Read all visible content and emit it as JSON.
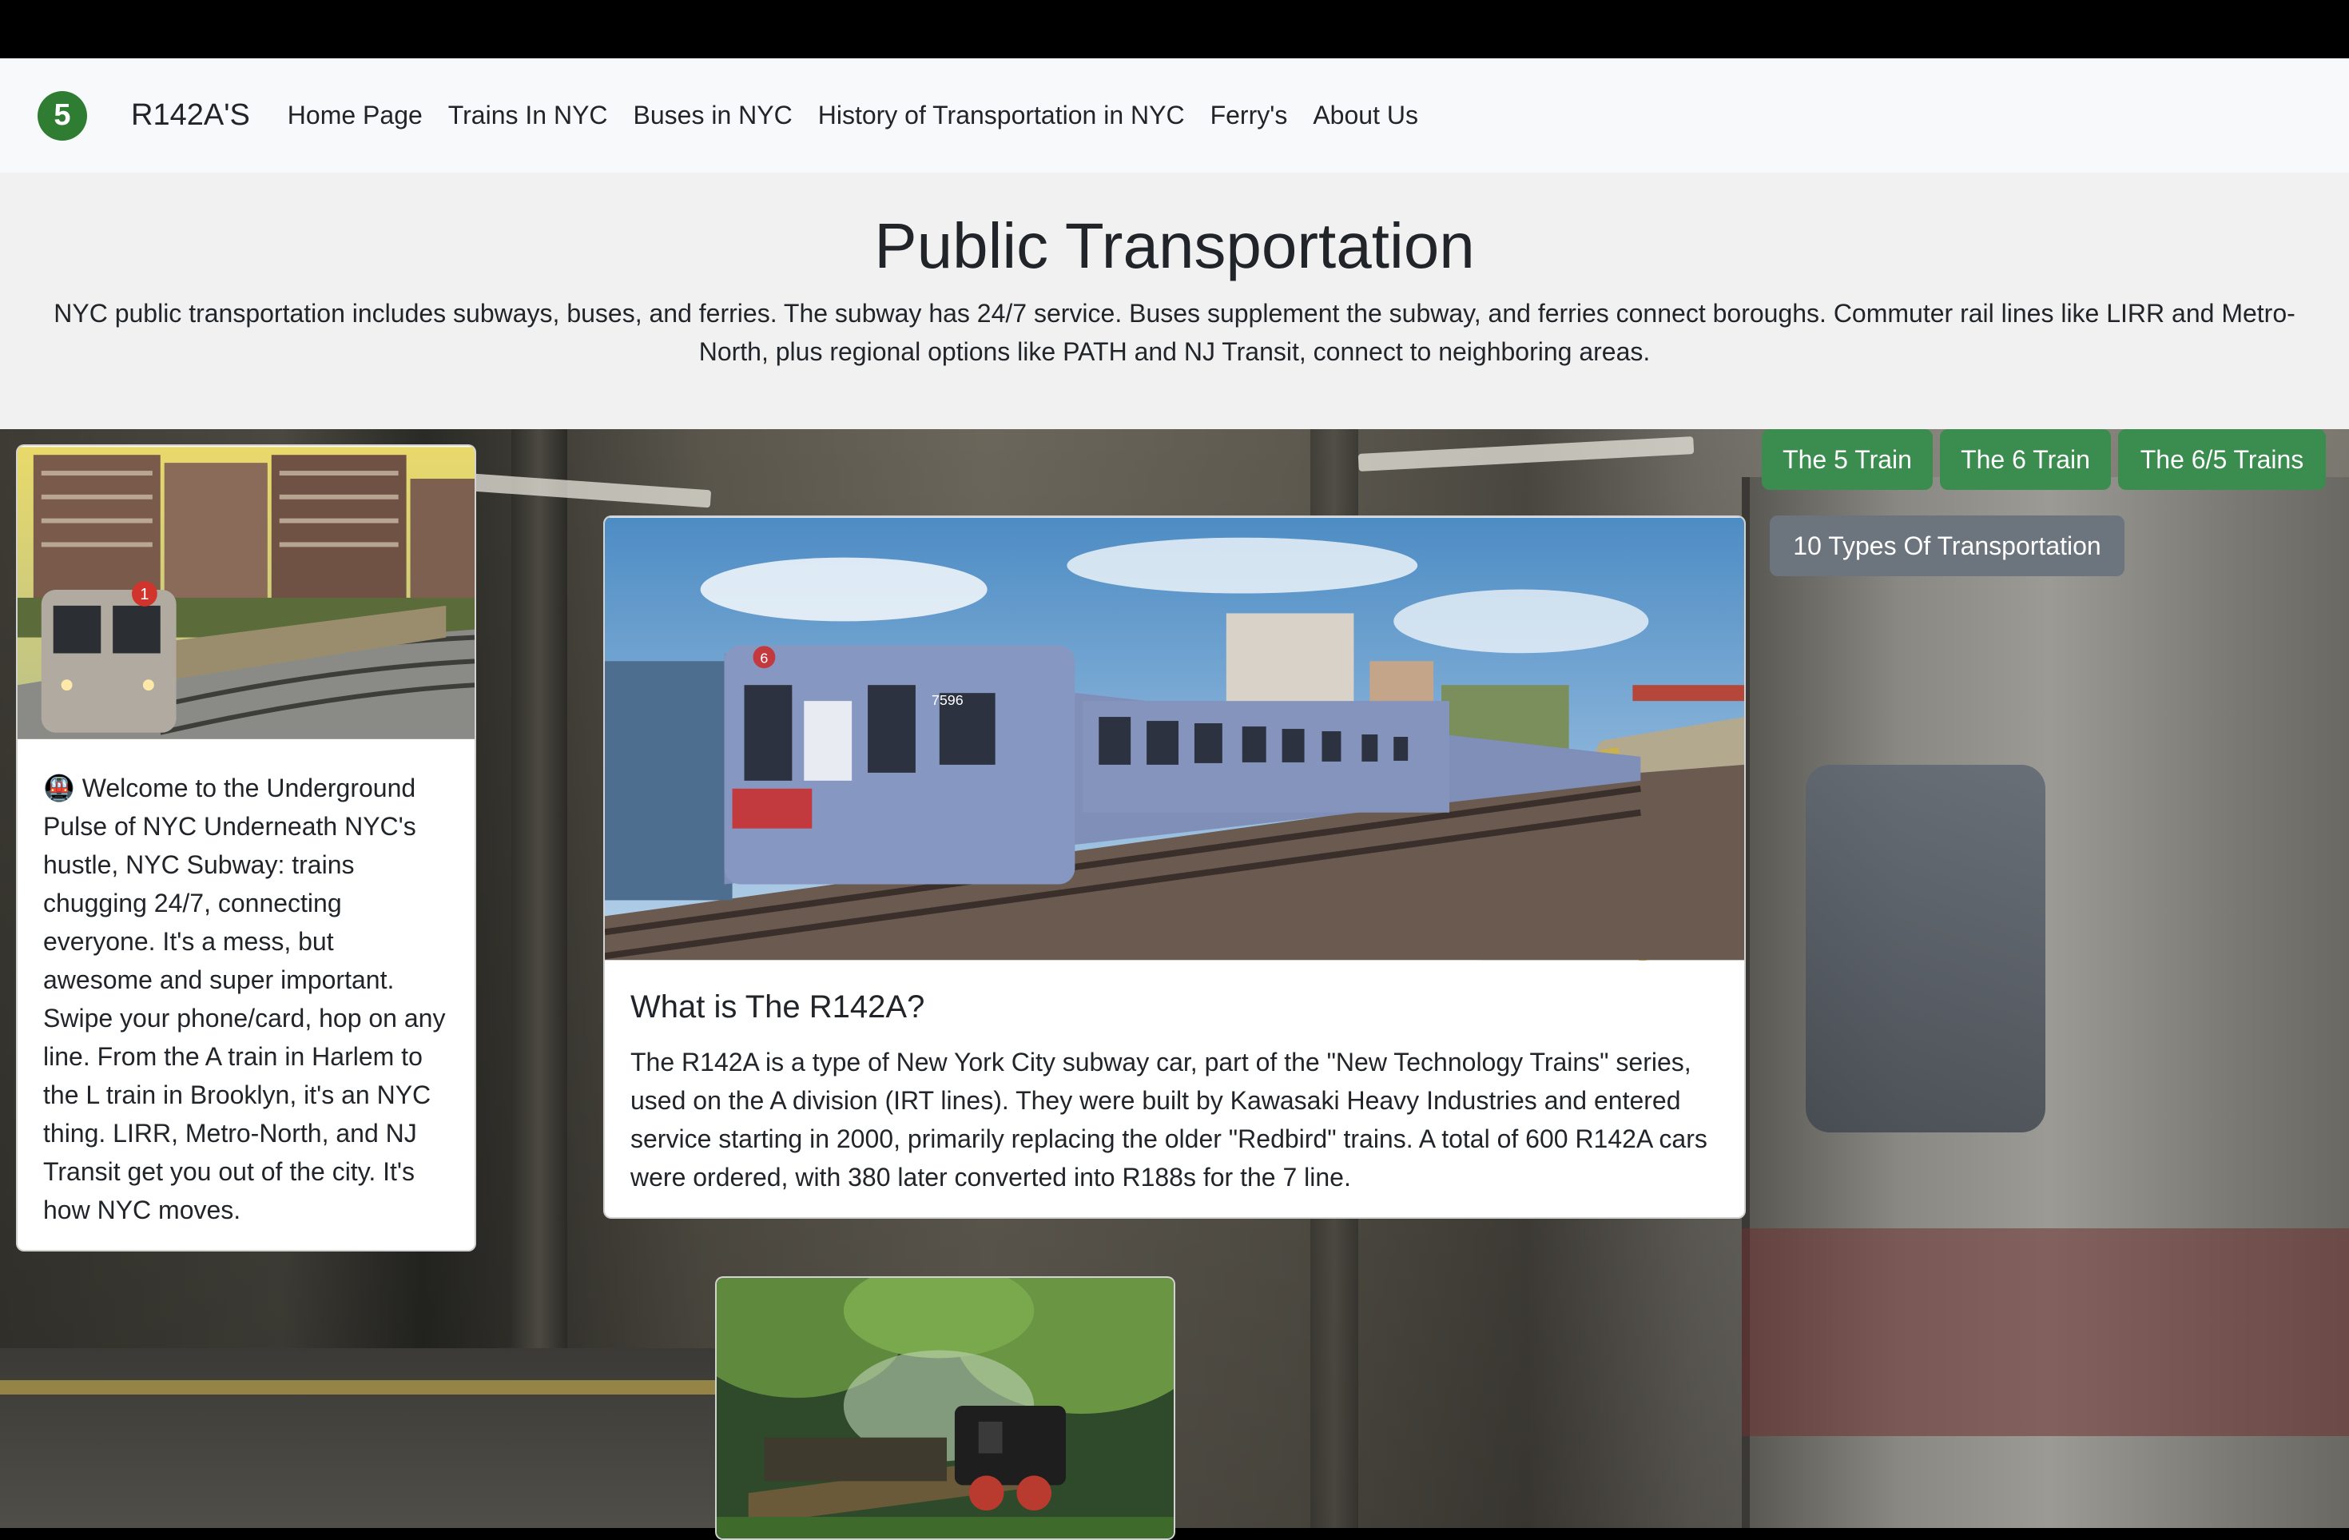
{
  "navbar": {
    "logo_text": "5",
    "brand": "R142A'S",
    "links": [
      "Home Page",
      "Trains In NYC",
      "Buses in NYC",
      "History of Transportation in NYC",
      "Ferry's",
      "About Us"
    ]
  },
  "hero": {
    "title": "Public Transportation",
    "description": "NYC public transportation includes subways, buses, and ferries. The subway has 24/7 service. Buses supplement the subway, and ferries connect boroughs. Commuter rail lines like LIRR and Metro-North, plus regional options like PATH and NJ Transit, connect to neighboring areas."
  },
  "buttons": {
    "train5": "The 5 Train",
    "train6": "The 6 Train",
    "train65": "The 6/5 Trains",
    "types": "10 Types Of Transportation"
  },
  "cards": {
    "welcome": {
      "emoji": "🚇",
      "text": "Welcome to the Underground Pulse of NYC Underneath NYC's hustle, NYC Subway: trains chugging 24/7, connecting everyone. It's a mess, but awesome and super important. Swipe your phone/card, hop on any line. From the A train in Harlem to the L train in Brooklyn, it's an NYC thing. LIRR, Metro-North, and NJ Transit get you out of the city. It's how NYC moves."
    },
    "r142a": {
      "title": "What is The R142A?",
      "text": "The R142A is a type of New York City subway car, part of the \"New Technology Trains\" series, used on the A division (IRT lines). They were built by Kawasaki Heavy Industries and entered service starting in 2000, primarily replacing the older \"Redbird\" trains. A total of 600 R142A cars were ordered, with 380 later converted into R188s for the 7 line."
    },
    "train1_badge": "1",
    "r142_car_badge": "6",
    "r142_car_number": "7596"
  },
  "colors": {
    "accent_green": "#3a8d4f",
    "logo_green": "#2e7d32",
    "button_gray": "#6c757d"
  }
}
